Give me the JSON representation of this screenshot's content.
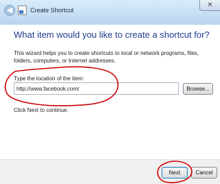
{
  "window": {
    "title": "Create Shortcut",
    "close_glyph": "✕",
    "back_glyph": "◀"
  },
  "main": {
    "heading": "What item would you like to create a shortcut for?",
    "description": "This wizard helps you to create shortcuts to local or network programs, files, folders, computers, or Internet addresses.",
    "location_label": "Type the location of the item:",
    "location_value": "http://www.facebook.com/",
    "browse_label": "Browse...",
    "hint": "Click Next to continue."
  },
  "footer": {
    "next_label": "Next",
    "cancel_label": "Cancel"
  },
  "annotation_color": "#cc0000",
  "icons": [
    "back-arrow-icon",
    "shortcut-app-icon",
    "close-icon"
  ]
}
